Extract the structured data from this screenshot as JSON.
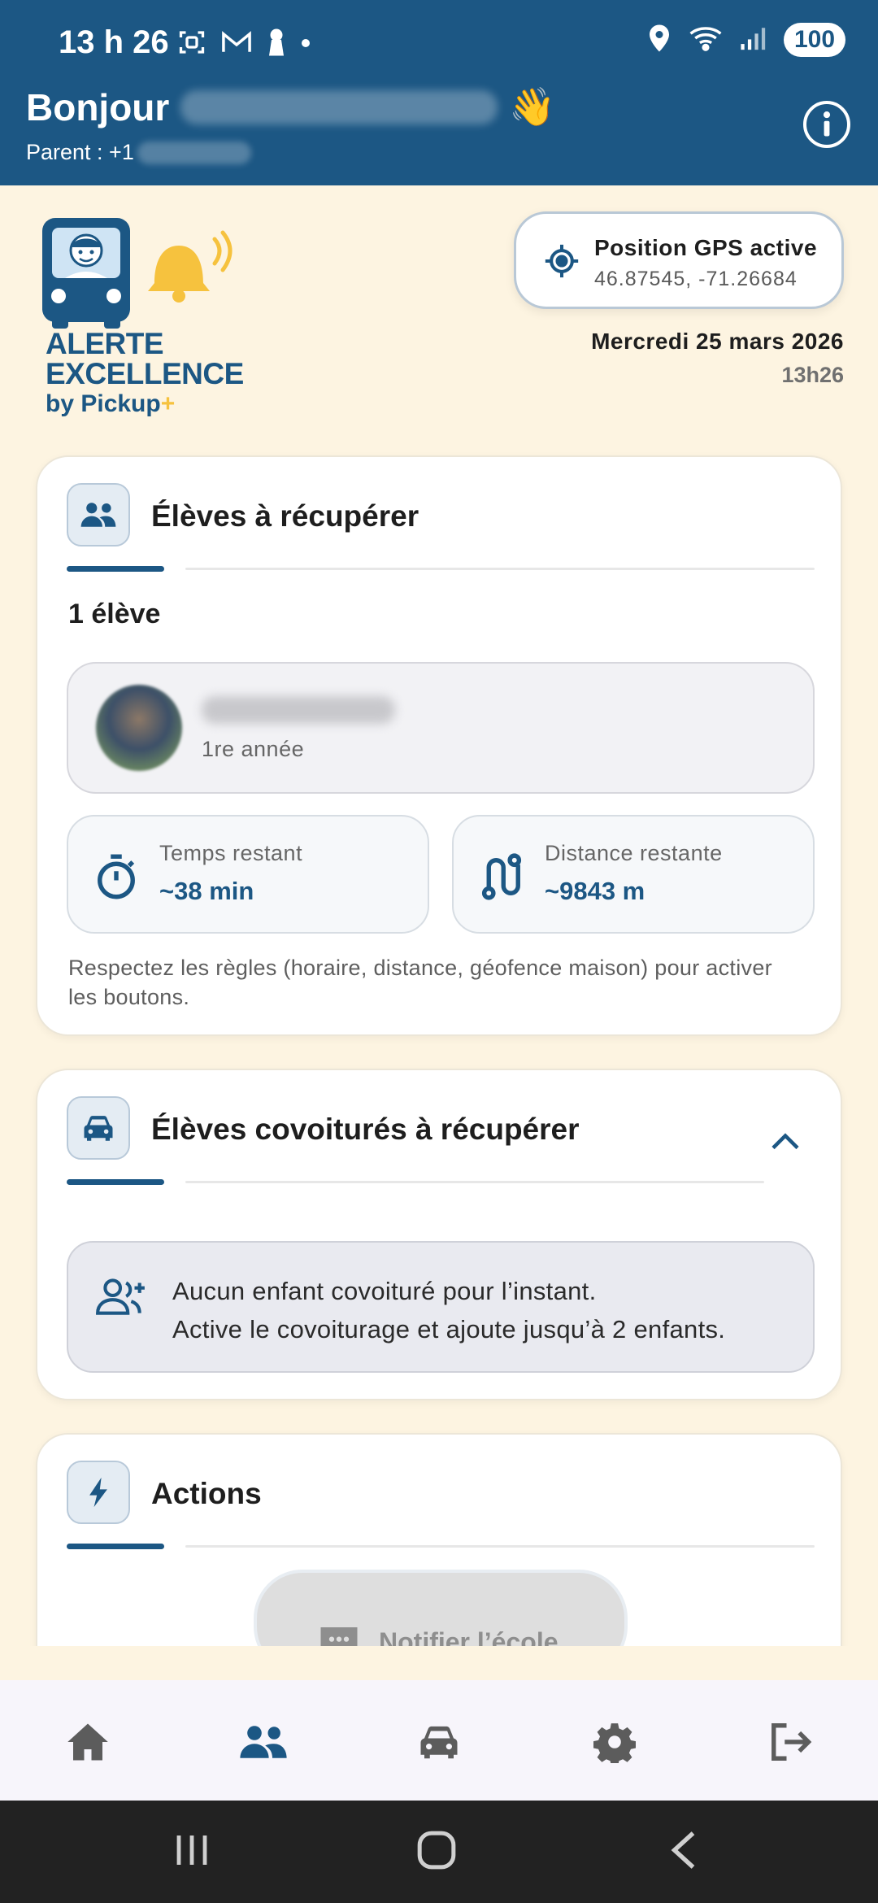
{
  "status_bar": {
    "time": "13 h 26",
    "battery": "100",
    "icons_left": [
      "screenshot-icon",
      "gmail-icon",
      "keyhole-icon",
      "dot-icon"
    ],
    "icons_right": [
      "location-icon",
      "wifi-icon",
      "signal-icon",
      "battery-icon"
    ]
  },
  "header": {
    "greeting": "Bonjour",
    "greeting_emoji": "👋",
    "parent_prefix": "Parent : +1",
    "info_icon": "info-icon",
    "background": "#1c5784"
  },
  "logo": {
    "line1": "ALERTE",
    "line2": "EXCELLENCE",
    "line3": "by Pickup",
    "plus": "+",
    "accent": "#f6c23e"
  },
  "gps": {
    "title": "Position GPS active",
    "coords": "46.87545, -71.26684"
  },
  "date_block": {
    "date": "Mercredi 25 mars 2026",
    "time": "13h26"
  },
  "students_card": {
    "title": "Élèves à récupérer",
    "count": "1 élève",
    "student": {
      "grade": "1re année"
    },
    "time_label": "Temps restant",
    "time_value": "~38 min",
    "distance_label": "Distance restante",
    "distance_value": "~9843 m",
    "rules": "Respectez les règles (horaire, distance, géofence maison) pour activer les boutons."
  },
  "carpool_card": {
    "title": "Élèves covoiturés à récupérer",
    "empty_line1": "Aucun enfant covoituré pour l’instant.",
    "empty_line2": "Active le covoiturage et ajoute jusqu’à 2 enfants."
  },
  "actions_card": {
    "title": "Actions",
    "notify_label": "Notifier l’école"
  },
  "bottom_nav": {
    "items": [
      "home-icon",
      "students-icon",
      "car-icon",
      "settings-icon",
      "logout-icon"
    ],
    "active": "students-icon",
    "active_color": "#1c5784",
    "inactive_color": "#5c5c5c"
  }
}
